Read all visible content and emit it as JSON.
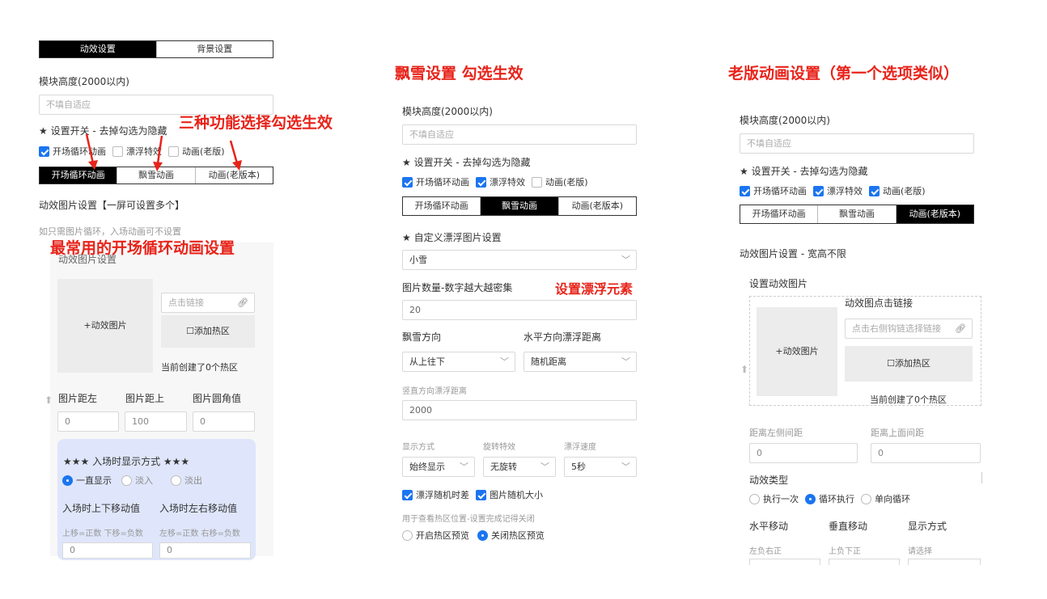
{
  "annotations": {
    "three_functions": "三种功能选择勾选生效",
    "common_open_anim": "最常用的开场循环动画设置",
    "snow_title": "飘雪设置 勾选生效",
    "float_elements": "设置漂浮元素",
    "old_title": "老版动画设置（第一个选项类似）",
    "accent_color": "#e8231a"
  },
  "panel1": {
    "tabs": [
      "动效设置",
      "背景设置"
    ],
    "height_label": "模块高度(2000以内)",
    "height_placeholder": "不填自适应",
    "switch_label": "★ 设置开关 - 去掉勾选为隐藏",
    "checks": [
      {
        "label": "开场循环动画",
        "checked": true
      },
      {
        "label": "漂浮特效",
        "checked": false
      },
      {
        "label": "动画(老版)",
        "checked": false
      }
    ],
    "subtabs": [
      "开场循环动画",
      "飘雪动画",
      "动画(老版本)"
    ],
    "image_setting": "动效图片设置【一屏可设置多个】",
    "hint": "如只需图片循环，入场动画可不设置",
    "image_title": "动效图片设置",
    "add_image": "+动效图片",
    "link_placeholder": "点击链接",
    "add_hotspot": "添加热区",
    "hotspot_count": "当前创建了0个热区",
    "pos_labels": [
      "图片距左",
      "图片距上",
      "图片圆角值"
    ],
    "pos_values": [
      "0",
      "100",
      "0"
    ],
    "entry_title": "★★★ 入场时显示方式 ★★★",
    "entry_options": [
      {
        "label": "一直显示",
        "checked": true
      },
      {
        "label": "淡入",
        "checked": false
      },
      {
        "label": "淡出",
        "checked": false
      }
    ],
    "move_labels": [
      "入场时上下移动值",
      "入场时左右移动值"
    ],
    "move_hints": [
      "上移=正数 下移=负数",
      "左移=正数 右移=负数"
    ],
    "move_values": [
      "0",
      "0"
    ]
  },
  "panel2": {
    "height_label": "模块高度(2000以内)",
    "height_placeholder": "不填自适应",
    "switch_label": "★ 设置开关 - 去掉勾选为隐藏",
    "checks": [
      {
        "label": "开场循环动画",
        "checked": true
      },
      {
        "label": "漂浮特效",
        "checked": true
      },
      {
        "label": "动画(老版)",
        "checked": false
      }
    ],
    "subtabs": [
      "开场循环动画",
      "飘雪动画",
      "动画(老版本)"
    ],
    "custom_label": "★ 自定义漂浮图片设置",
    "custom_value": "小雪",
    "count_label": "图片数量-数字越大越密集",
    "count_value": "20",
    "direction_label": "飘雪方向",
    "horizontal_label": "水平方向漂浮距离",
    "direction_value": "从上往下",
    "horizontal_value": "随机距离",
    "vertical_label": "竖直方向漂浮距离",
    "vertical_value": "2000",
    "display_labels": [
      "显示方式",
      "旋转特效",
      "漂浮速度"
    ],
    "display_values": [
      "始终显示",
      "无旋转",
      "5秒"
    ],
    "random_checks": [
      {
        "label": "漂浮随机时差",
        "checked": true
      },
      {
        "label": "图片随机大小",
        "checked": true
      }
    ],
    "preview_hint": "用于查看热区位置-设置完成记得关闭",
    "preview_options": [
      {
        "label": "开启热区预览",
        "checked": false
      },
      {
        "label": "关闭热区预览",
        "checked": true
      }
    ]
  },
  "panel3": {
    "height_label": "模块高度(2000以内)",
    "height_placeholder": "不填自适应",
    "switch_label": "★ 设置开关 - 去掉勾选为隐藏",
    "checks": [
      {
        "label": "开场循环动画",
        "checked": true
      },
      {
        "label": "漂浮特效",
        "checked": true
      },
      {
        "label": "动画(老版)",
        "checked": true
      }
    ],
    "subtabs": [
      "开场循环动画",
      "飘雪动画",
      "动画(老版本)"
    ],
    "image_setting": "动效图片设置 - 宽高不限",
    "set_image": "设置动效图片",
    "link_title": "动效图点击链接",
    "add_image": "+动效图片",
    "link_placeholder": "点击右侧钩链选择链接",
    "add_hotspot": "添加热区",
    "hotspot_count": "当前创建了0个热区",
    "dist_labels": [
      "距离左侧间距",
      "距离上面间距"
    ],
    "dist_values": [
      "0",
      "0"
    ],
    "type_label": "动效类型",
    "type_options": [
      {
        "label": "执行一次",
        "checked": false
      },
      {
        "label": "循环执行",
        "checked": true
      },
      {
        "label": "单向循环",
        "checked": false
      }
    ],
    "col_labels": [
      "水平移动",
      "垂直移动",
      "显示方式"
    ],
    "col_hints": [
      "左负右正",
      "上负下正",
      "请选择"
    ]
  }
}
